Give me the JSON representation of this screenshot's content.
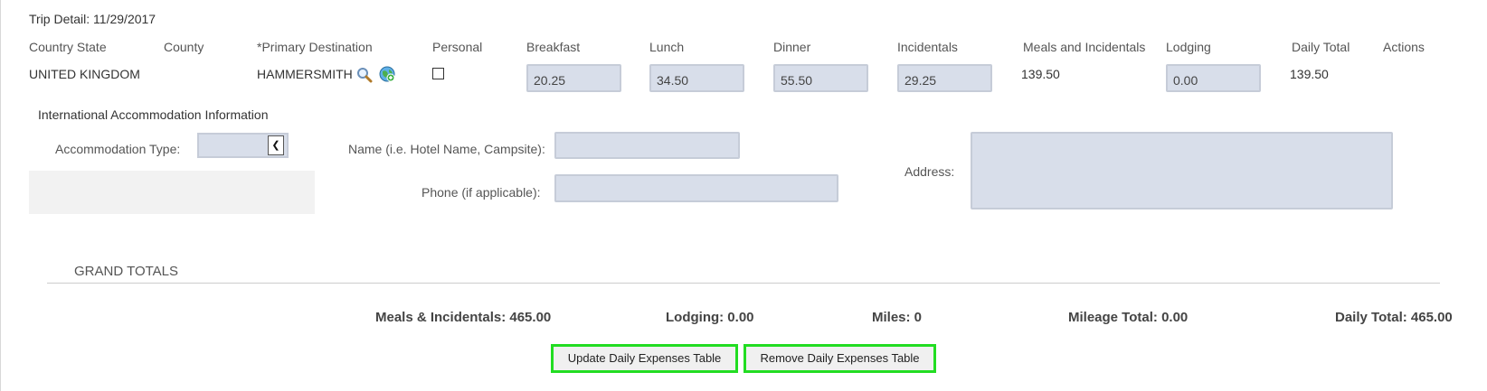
{
  "trip_detail": {
    "title": "Trip Detail: 11/29/2017"
  },
  "columns": {
    "country_state": "Country State",
    "county": "County",
    "primary_destination": "*Primary Destination",
    "personal": "Personal",
    "breakfast": "Breakfast",
    "lunch": "Lunch",
    "dinner": "Dinner",
    "incidentals": "Incidentals",
    "meals_incidentals": "Meals and Incidentals",
    "lodging": "Lodging",
    "daily_total": "Daily Total",
    "actions": "Actions"
  },
  "row": {
    "country_state": "UNITED KINGDOM",
    "county": "",
    "primary_destination": "HAMMERSMITH",
    "personal_checked": false,
    "breakfast": "20.25",
    "lunch": "34.50",
    "dinner": "55.50",
    "incidentals": "29.25",
    "meals_incidentals": "139.50",
    "lodging": "0.00",
    "daily_total": "139.50"
  },
  "accommodation": {
    "section_title": "International Accommodation Information",
    "type_label": "Accommodation Type:",
    "type_value": "",
    "name_label": "Name (i.e. Hotel Name, Campsite):",
    "name_value": "",
    "phone_label": "Phone (if applicable):",
    "phone_value": "",
    "address_label": "Address:",
    "address_value": ""
  },
  "grand_totals": {
    "title": "GRAND TOTALS",
    "meals_incidentals": "Meals & Incidentals: 465.00",
    "lodging": "Lodging: 0.00",
    "miles": "Miles: 0",
    "mileage_total": "Mileage Total: 0.00",
    "daily_total": "Daily Total: 465.00"
  },
  "buttons": {
    "update": "Update Daily Expenses Table",
    "remove": "Remove Daily Expenses Table"
  },
  "icons": {
    "search": "magnifier-icon",
    "map": "globe-icon"
  },
  "colors": {
    "field_bg": "#d8deea",
    "highlight_border": "#22dd22"
  }
}
